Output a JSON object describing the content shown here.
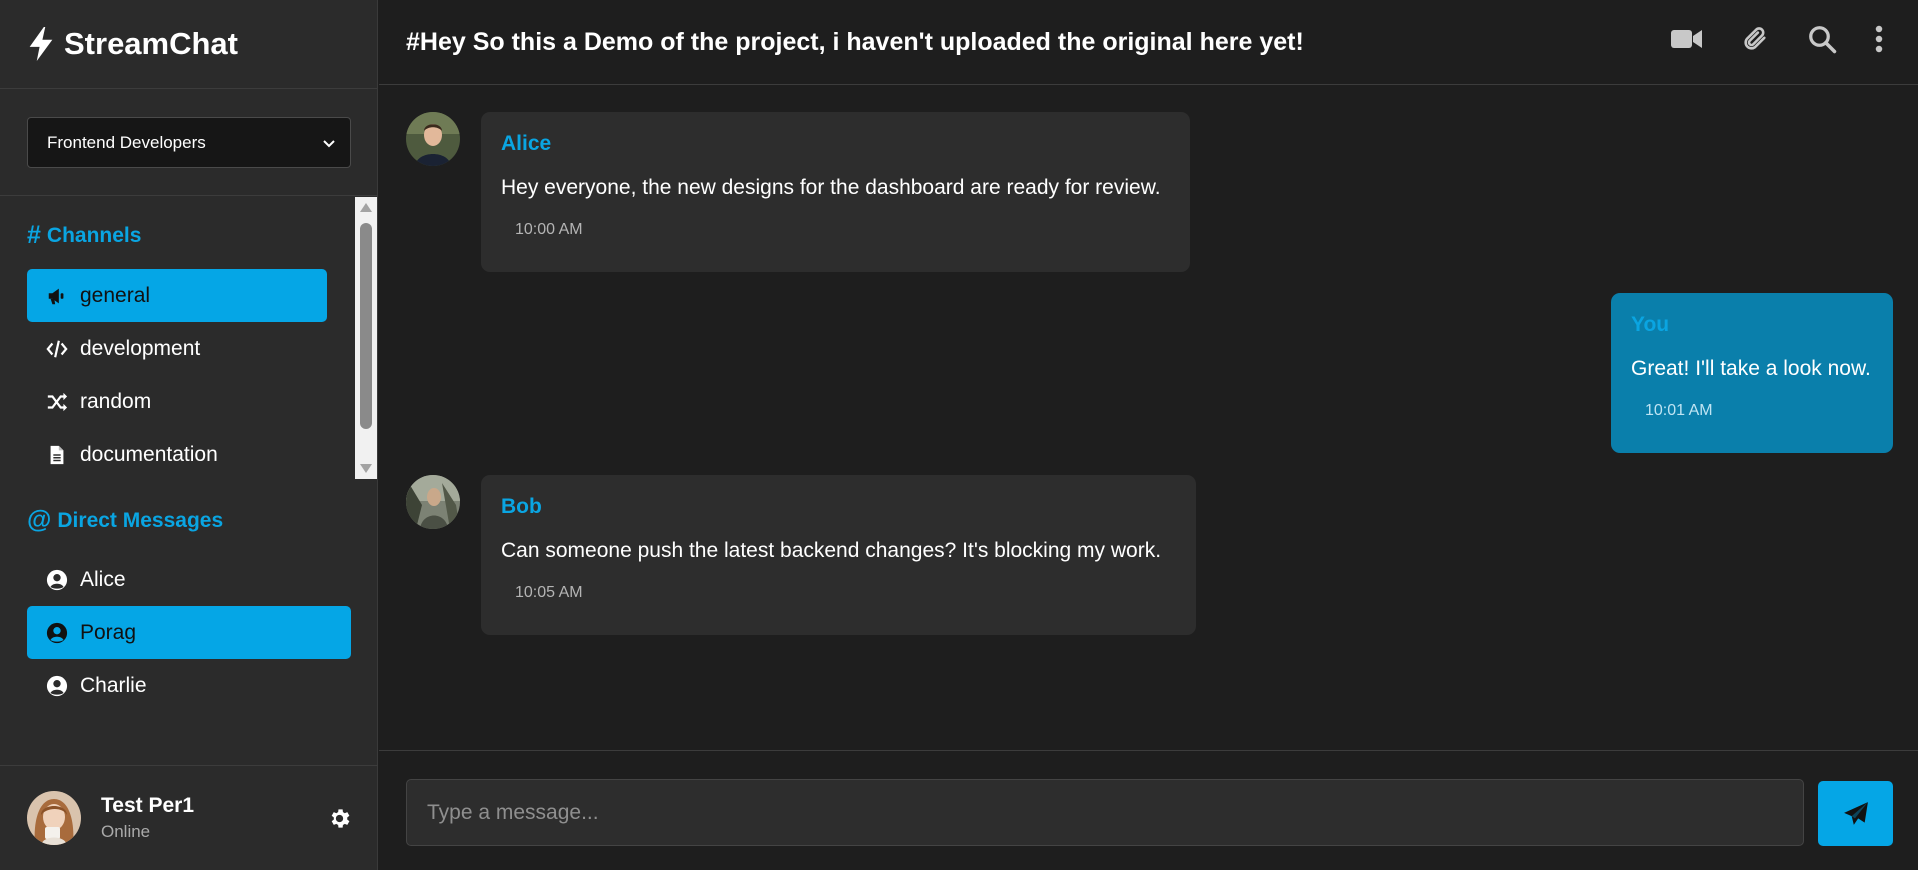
{
  "app": {
    "name": "StreamChat"
  },
  "workspace": {
    "selected": "Frontend Developers"
  },
  "sidebar": {
    "channels_title": "Channels",
    "channels_symbol": "#",
    "channels": [
      {
        "label": "general",
        "icon": "megaphone-icon",
        "active": true
      },
      {
        "label": "development",
        "icon": "code-icon",
        "active": false
      },
      {
        "label": "random",
        "icon": "shuffle-icon",
        "active": false
      },
      {
        "label": "documentation",
        "icon": "file-icon",
        "active": false
      }
    ],
    "dm_title": "Direct Messages",
    "dm_symbol": "@",
    "dms": [
      {
        "label": "Alice",
        "icon": "user-circle-icon",
        "active": false
      },
      {
        "label": "Porag",
        "icon": "user-circle-icon",
        "active": true
      },
      {
        "label": "Charlie",
        "icon": "user-circle-icon",
        "active": false
      }
    ]
  },
  "current_user": {
    "name": "Test Per1",
    "status": "Online"
  },
  "header": {
    "title": "#Hey So this a Demo of the project, i haven't uploaded the original here yet!"
  },
  "messages": [
    {
      "sender": "Alice",
      "text": "Hey everyone, the new designs for the dashboard are ready for review.",
      "time": "10:00 AM",
      "mine": false
    },
    {
      "sender": "You",
      "text": "Great! I'll take a look now.",
      "time": "10:01 AM",
      "mine": true
    },
    {
      "sender": "Bob",
      "text": "Can someone push the latest backend changes? It's blocking my work.",
      "time": "10:05 AM",
      "mine": false
    }
  ],
  "composer": {
    "placeholder": "Type a message..."
  },
  "colors": {
    "accent": "#05a6e6",
    "mine_bubble": "#0a7fab",
    "bubble": "#2d2d2d",
    "background": "#1e1e1e",
    "sidebar": "#2b2b2b"
  }
}
